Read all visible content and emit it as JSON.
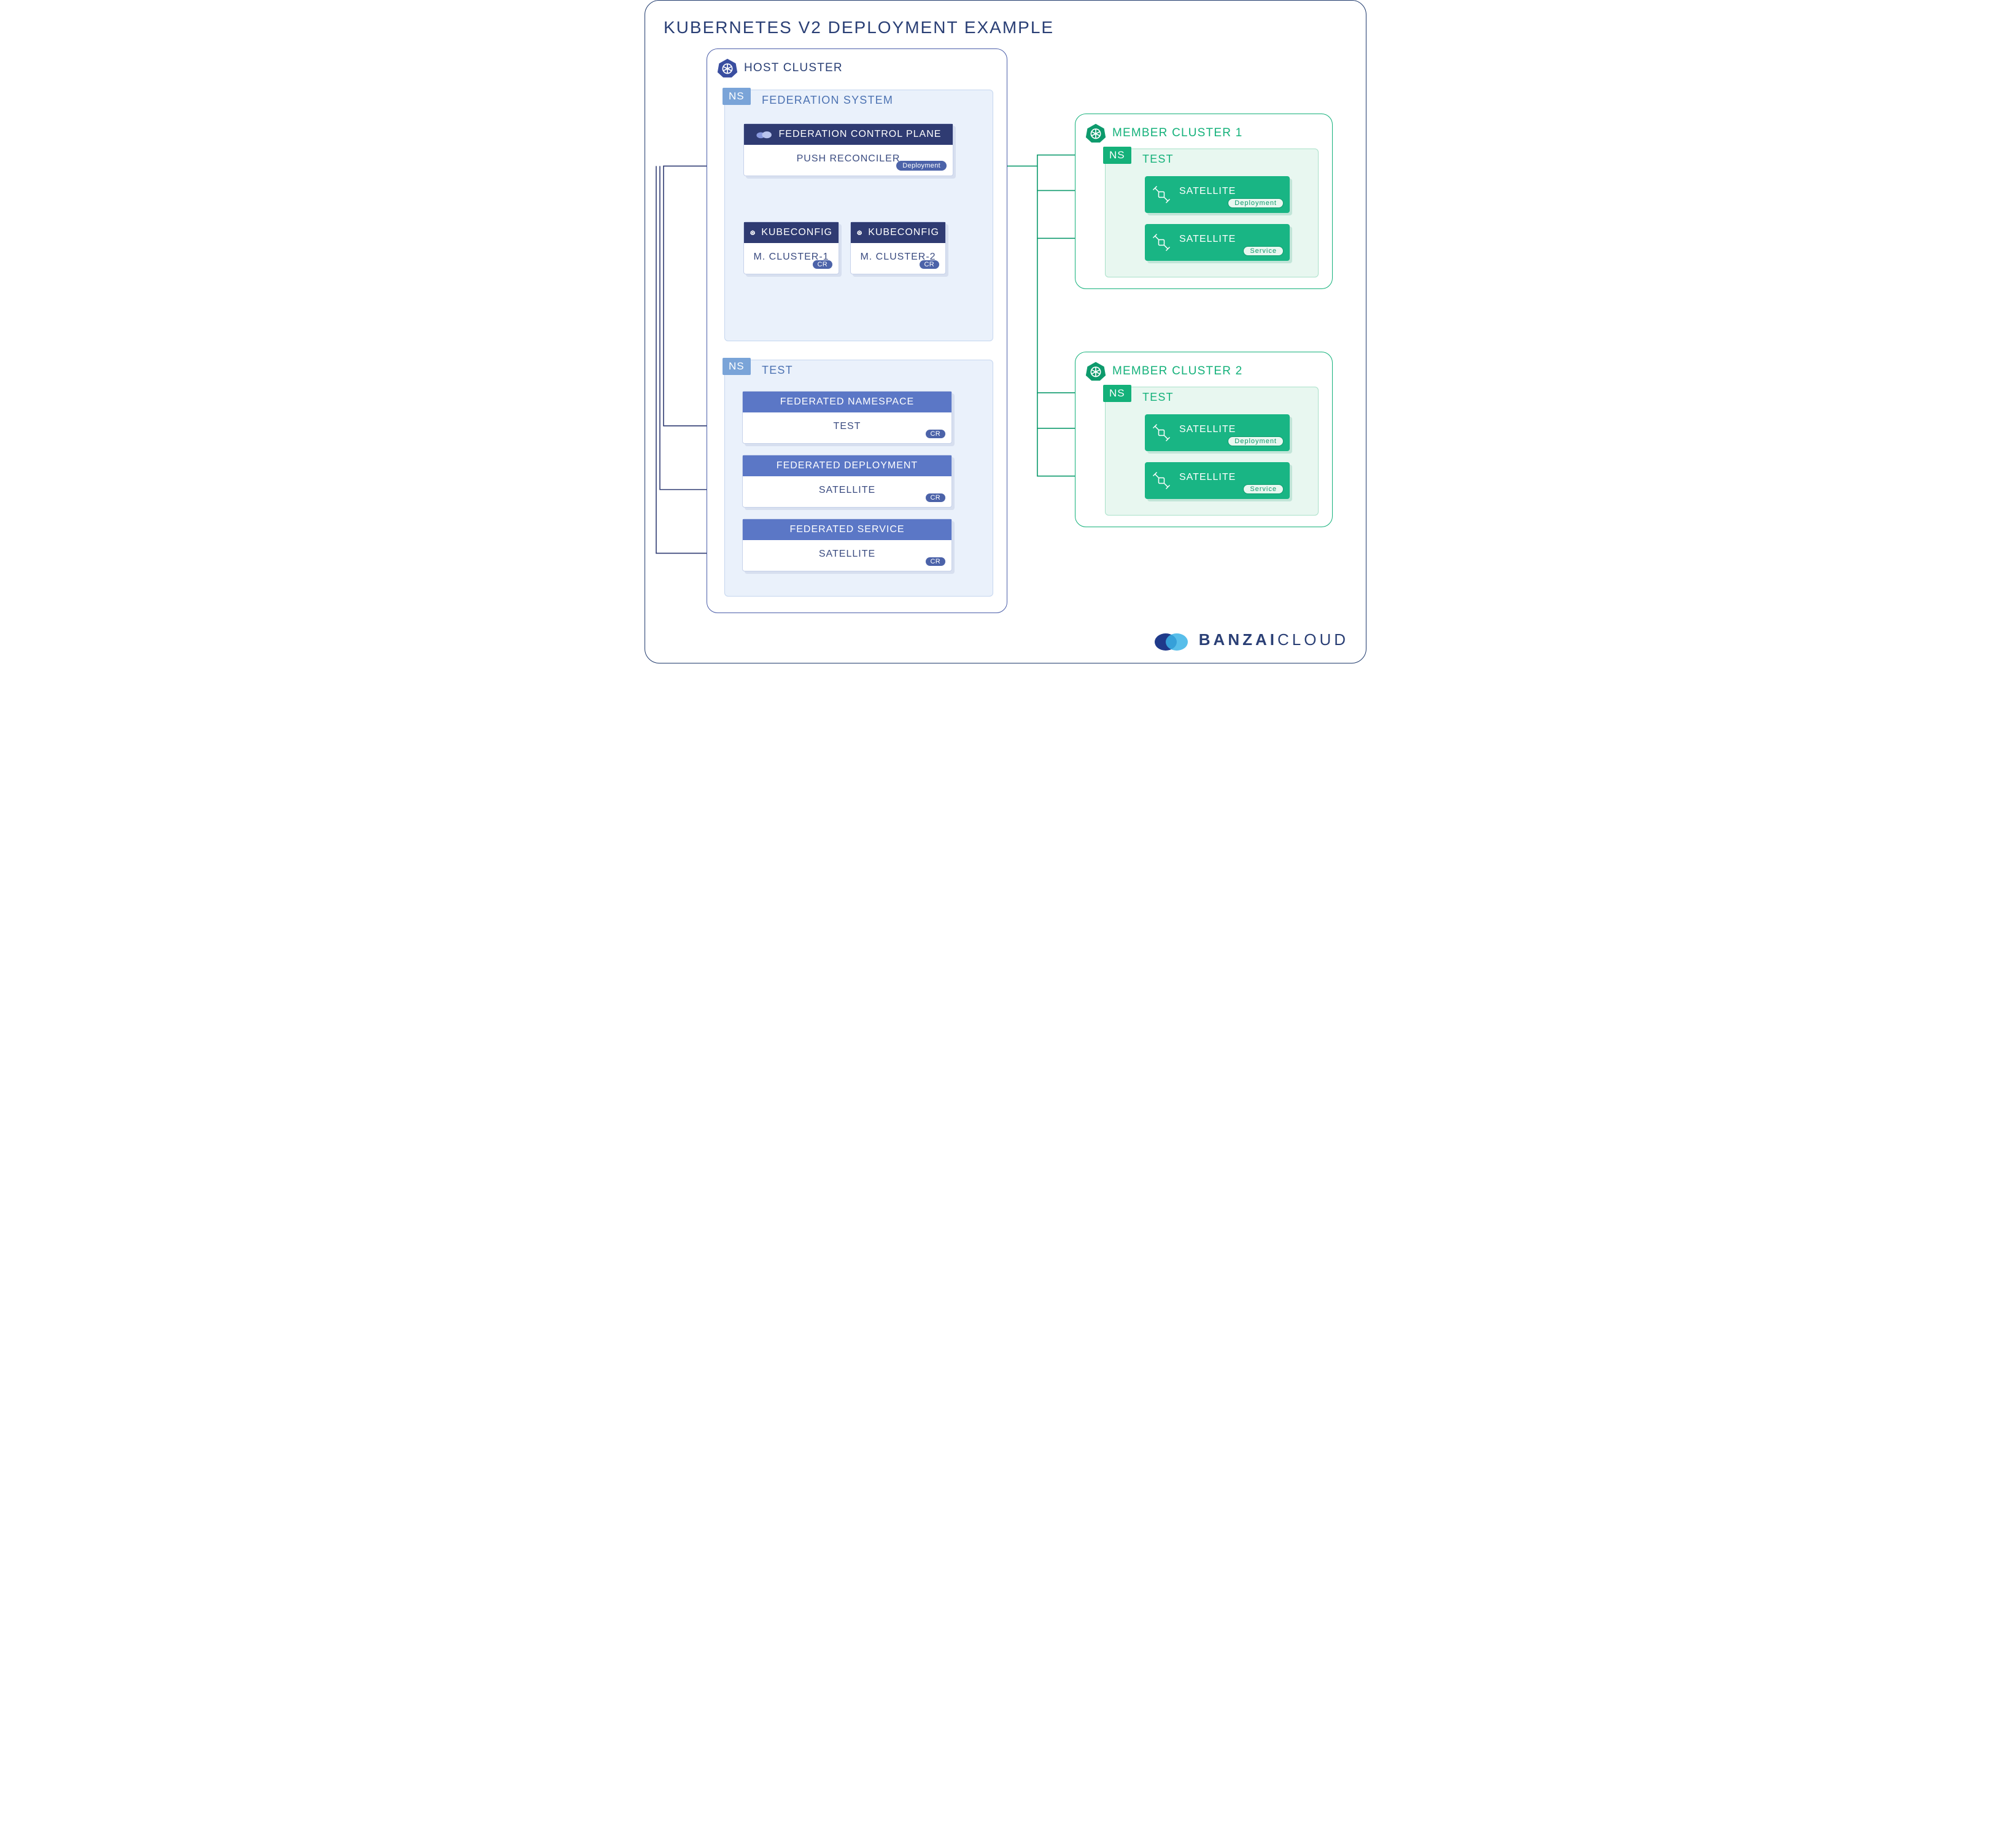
{
  "title": "KUBERNETES V2 DEPLOYMENT EXAMPLE",
  "host": {
    "title": "HOST CLUSTER",
    "fedsys": {
      "ns_tag": "NS",
      "label": "FEDERATION SYSTEM",
      "plane": {
        "header": "FEDERATION CONTROL PLANE",
        "body": "PUSH RECONCILER",
        "pill": "Deployment"
      },
      "kube1": {
        "header": "KUBECONFIG",
        "body": "M. CLUSTER-1",
        "pill": "CR"
      },
      "kube2": {
        "header": "KUBECONFIG",
        "body": "M. CLUSTER-2",
        "pill": "CR"
      }
    },
    "test": {
      "ns_tag": "NS",
      "label": "TEST",
      "fedns": {
        "header": "FEDERATED NAMESPACE",
        "body": "TEST",
        "pill": "CR"
      },
      "feddep": {
        "header": "FEDERATED DEPLOYMENT",
        "body": "SATELLITE",
        "pill": "CR"
      },
      "fedsvc": {
        "header": "FEDERATED SERVICE",
        "body": "SATELLITE",
        "pill": "CR"
      }
    }
  },
  "members": [
    {
      "title": "MEMBER CLUSTER 1",
      "ns_tag": "NS",
      "label": "TEST",
      "sat1": {
        "name": "SATELLITE",
        "pill": "Deployment"
      },
      "sat2": {
        "name": "SATELLITE",
        "pill": "Service"
      }
    },
    {
      "title": "MEMBER CLUSTER 2",
      "ns_tag": "NS",
      "label": "TEST",
      "sat1": {
        "name": "SATELLITE",
        "pill": "Deployment"
      },
      "sat2": {
        "name": "SATELLITE",
        "pill": "Service"
      }
    }
  ],
  "brand": {
    "b": "BANZAI",
    "r": "CLOUD"
  }
}
